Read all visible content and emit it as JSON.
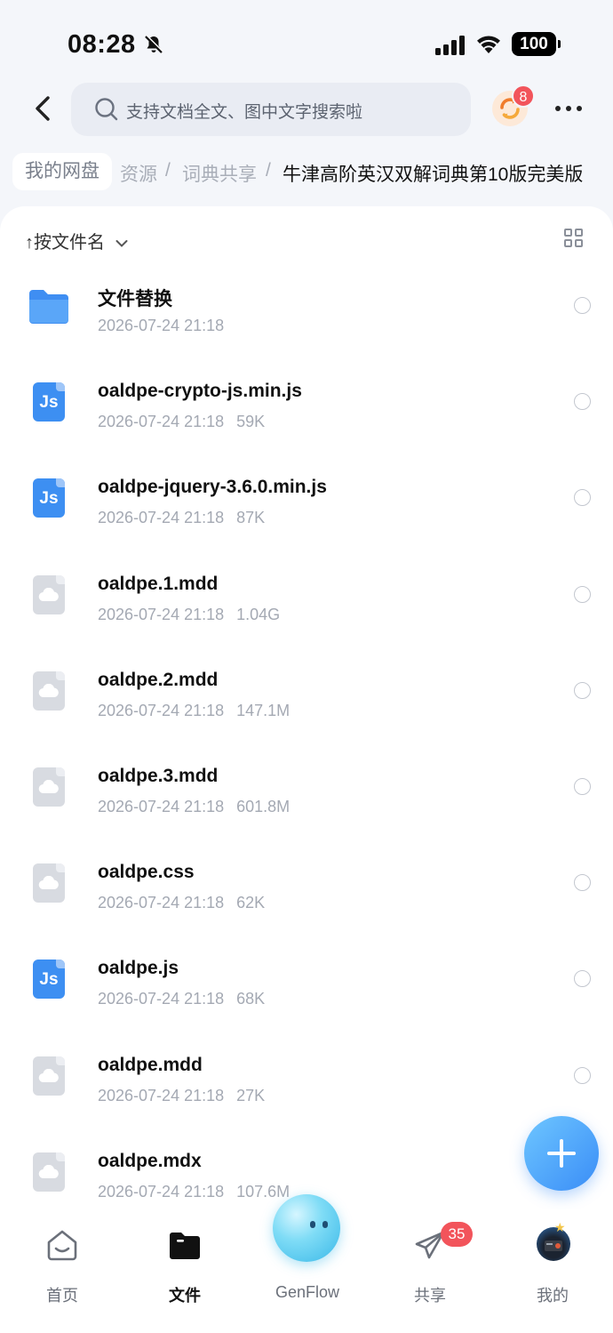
{
  "status_bar": {
    "time": "08:28",
    "battery": "100"
  },
  "header": {
    "search_placeholder": "支持文档全文、图中文字搜索啦",
    "sync_badge": "8"
  },
  "breadcrumb": {
    "home": "我的网盘",
    "items": [
      "资源",
      "/",
      "词典共享",
      "/"
    ],
    "current": "牛津高阶英汉双解词典第10版完美版"
  },
  "toolbar": {
    "sort_label": "↑按文件名"
  },
  "files": [
    {
      "name": "文件替换",
      "date": "2026-07-24 21:18",
      "size": "",
      "type": "folder"
    },
    {
      "name": "oaldpe-crypto-js.min.js",
      "date": "2026-07-24 21:18",
      "size": "59K",
      "type": "js"
    },
    {
      "name": "oaldpe-jquery-3.6.0.min.js",
      "date": "2026-07-24 21:18",
      "size": "87K",
      "type": "js"
    },
    {
      "name": "oaldpe.1.mdd",
      "date": "2026-07-24 21:18",
      "size": "1.04G",
      "type": "generic"
    },
    {
      "name": "oaldpe.2.mdd",
      "date": "2026-07-24 21:18",
      "size": "147.1M",
      "type": "generic"
    },
    {
      "name": "oaldpe.3.mdd",
      "date": "2026-07-24 21:18",
      "size": "601.8M",
      "type": "generic"
    },
    {
      "name": "oaldpe.css",
      "date": "2026-07-24 21:18",
      "size": "62K",
      "type": "generic"
    },
    {
      "name": "oaldpe.js",
      "date": "2026-07-24 21:18",
      "size": "68K",
      "type": "js"
    },
    {
      "name": "oaldpe.mdd",
      "date": "2026-07-24 21:18",
      "size": "27K",
      "type": "generic"
    },
    {
      "name": "oaldpe.mdx",
      "date": "2026-07-24 21:18",
      "size": "107.6M",
      "type": "generic"
    }
  ],
  "js_icon_text": "Js",
  "nav": {
    "home": "首页",
    "files": "文件",
    "genflow": "GenFlow",
    "share": "共享",
    "share_badge": "35",
    "mine": "我的"
  },
  "colors": {
    "accent": "#3a8df7",
    "badge": "#f2545b"
  }
}
